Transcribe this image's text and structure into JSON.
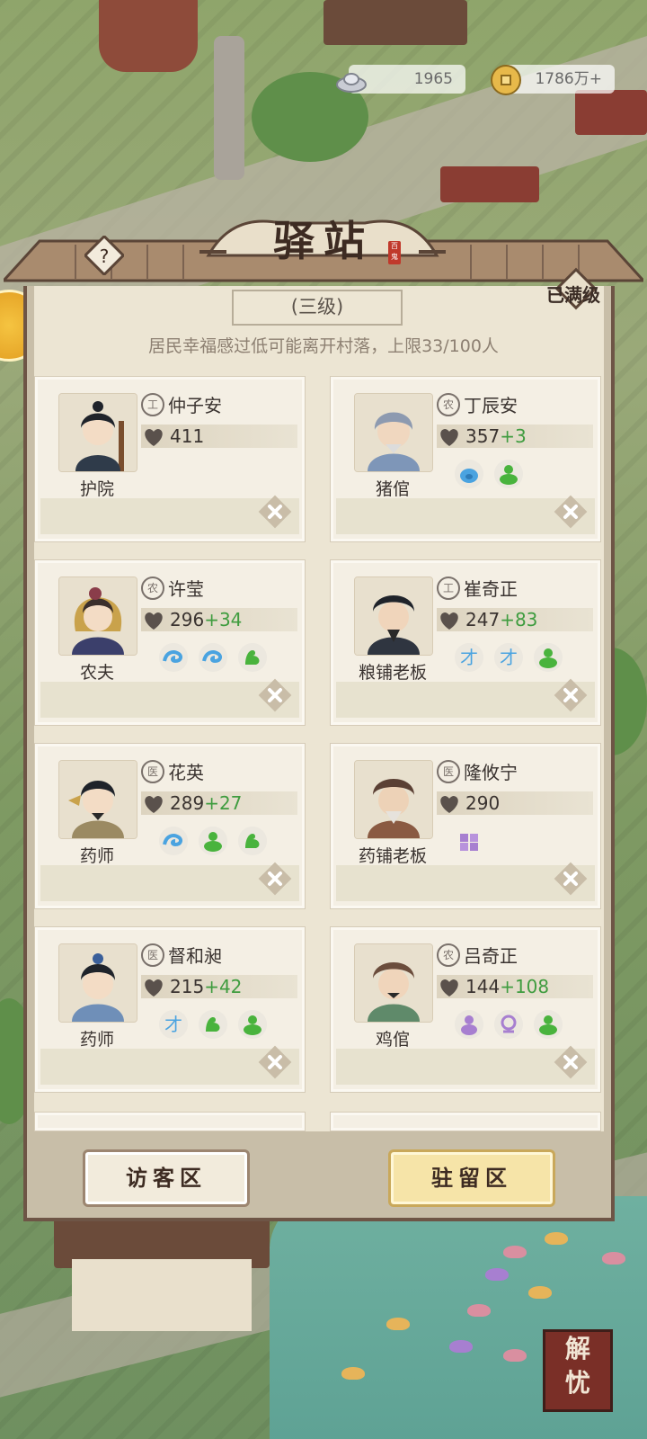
{
  "currency": {
    "silver": "1965",
    "coins": "1786万+"
  },
  "panel": {
    "title": "驿站",
    "seal": "百鬼",
    "max_level_label": "已满级",
    "level_label": "(三级)",
    "description": "居民幸福感过低可能离开村落，上限33/100人"
  },
  "residents": [
    {
      "name": "仲子安",
      "job": "护院",
      "badge": "工",
      "happiness": "411",
      "bonus": "",
      "traits": []
    },
    {
      "name": "丁辰安",
      "job": "猪倌",
      "badge": "农",
      "happiness": "357",
      "bonus": "+3",
      "traits": [
        "pig-icon",
        "green-figure-icon"
      ]
    },
    {
      "name": "许莹",
      "job": "农夫",
      "badge": "农",
      "happiness": "296",
      "bonus": "+34",
      "traits": [
        "blue-swirl-icon",
        "blue-swirl-icon",
        "green-muscle-icon"
      ]
    },
    {
      "name": "崔奇正",
      "job": "粮铺老板",
      "badge": "工",
      "happiness": "247",
      "bonus": "+83",
      "traits": [
        "talent-icon",
        "talent-icon",
        "green-figure-icon"
      ]
    },
    {
      "name": "花英",
      "job": "药师",
      "badge": "医",
      "happiness": "289",
      "bonus": "+27",
      "traits": [
        "blue-swirl-icon",
        "green-figure-icon",
        "green-muscle-icon"
      ]
    },
    {
      "name": "隆攸宁",
      "job": "药铺老板",
      "badge": "医",
      "happiness": "290",
      "bonus": "",
      "traits": [
        "purple-cubes-icon"
      ]
    },
    {
      "name": "督和昶",
      "job": "药师",
      "badge": "医",
      "happiness": "215",
      "bonus": "+42",
      "traits": [
        "talent-icon",
        "green-muscle-icon",
        "green-figure-icon"
      ]
    },
    {
      "name": "吕奇正",
      "job": "鸡倌",
      "badge": "农",
      "happiness": "144",
      "bonus": "+108",
      "traits": [
        "purple-figure-icon",
        "purple-ring-icon",
        "green-figure-icon"
      ]
    }
  ],
  "buttons": {
    "visitor_zone": "访客区",
    "stay_zone": "驻留区"
  },
  "corner_button": "解忧",
  "colors": {
    "panel_bg": "#ece5d3",
    "frame": "#6e5546",
    "bonus_green": "#3f9c3f",
    "stay_button": "#f6e4a8"
  }
}
